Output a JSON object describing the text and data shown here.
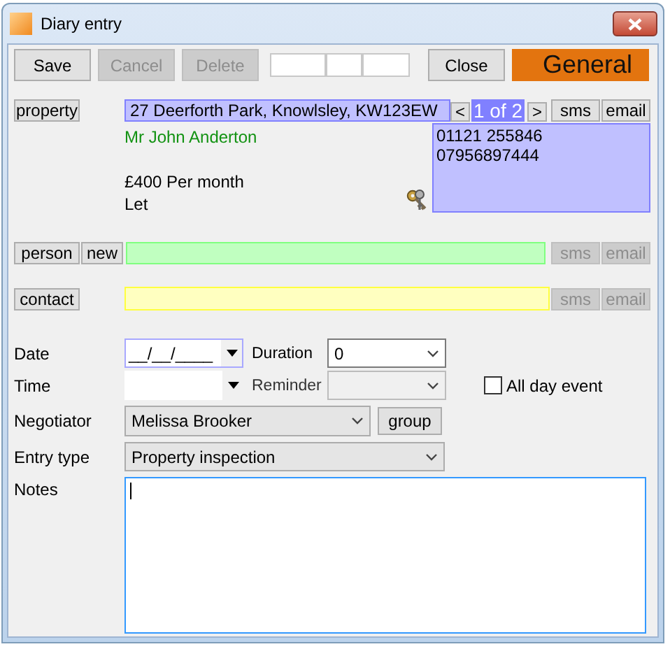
{
  "window": {
    "title": "Diary entry"
  },
  "toolbar": {
    "buttons": [
      {
        "label": "Save",
        "disabled": false
      },
      {
        "label": "Cancel",
        "disabled": true
      },
      {
        "label": "Delete",
        "disabled": true
      }
    ],
    "close": "Close",
    "category": "General"
  },
  "property": {
    "button": "property",
    "address": "27 Deerforth Park, Knowlsley, KW123EW",
    "prev": "<",
    "pager": "1 of 2",
    "next": ">",
    "actions": [
      {
        "label": "sms",
        "disabled": false
      },
      {
        "label": "email",
        "disabled": false
      }
    ],
    "landlord": "Mr John Anderton",
    "rent": "£400 Per month",
    "status": "Let",
    "phones": [
      "01121 255846",
      "07956897444"
    ]
  },
  "person": {
    "button": "person",
    "new": "new",
    "actions": [
      {
        "label": "sms",
        "disabled": true
      },
      {
        "label": "email",
        "disabled": true
      }
    ]
  },
  "contact": {
    "button": "contact",
    "actions": [
      {
        "label": "sms",
        "disabled": true
      },
      {
        "label": "email",
        "disabled": true
      }
    ]
  },
  "date": {
    "label": "Date",
    "value": "__/__/____"
  },
  "duration": {
    "label": "Duration",
    "value": "0"
  },
  "time": {
    "label": "Time"
  },
  "reminder": {
    "label": "Reminder",
    "disabled": true
  },
  "all_day": {
    "label": "All day event",
    "checked": false
  },
  "negotiator": {
    "label": "Negotiator",
    "value": "Melissa Brooker",
    "button": "group"
  },
  "entry_type": {
    "label": "Entry type",
    "value": "Property inspection"
  },
  "notes": {
    "label": "Notes"
  }
}
